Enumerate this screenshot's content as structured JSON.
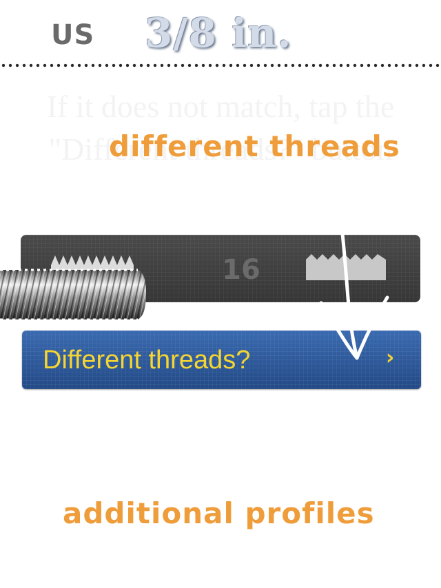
{
  "header": {
    "unit_system": "US",
    "size": "3/8 in."
  },
  "instruction": {
    "text": "If it does not match, tap the \"Different threads?\" button"
  },
  "annotations": {
    "top": "different threads",
    "bottom": "additional profiles",
    "color": "#ef9d3a"
  },
  "thread_panel": {
    "count": "16",
    "left_icon": "fine-thread-icon",
    "right_icon": "coarse-thread-icon"
  },
  "button": {
    "label": "Different threads?",
    "chevron": "›",
    "background": "#2f5da3",
    "text_color": "#f5d531"
  }
}
